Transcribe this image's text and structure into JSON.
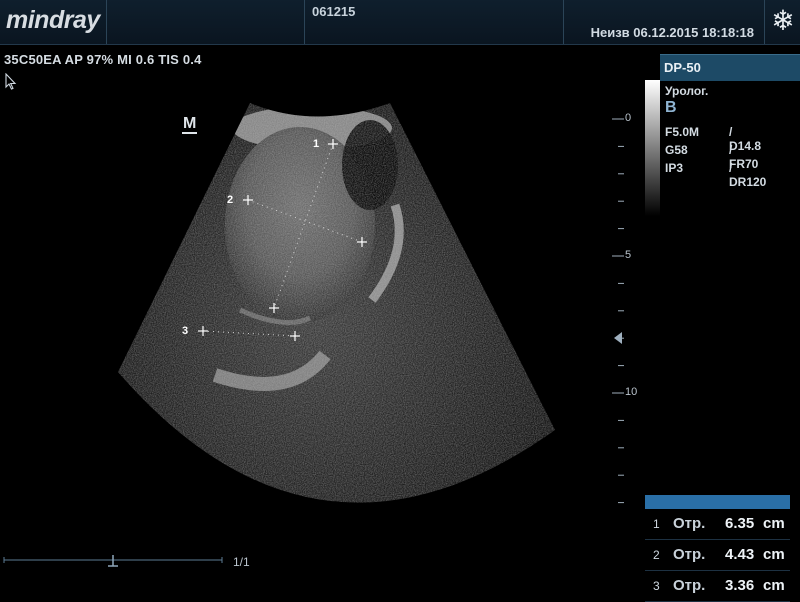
{
  "header": {
    "logo": "mindray",
    "patient_id": "061215",
    "datetime": "Неизв 06.12.2015   18:18:18",
    "freeze_icon": "snowflake-icon"
  },
  "probe_info": "35C50EA  AP 97%  MI 0.6 TIS 0.4",
  "orientation_marker": "M",
  "depth_scale": {
    "labels": [
      "0",
      "5",
      "10"
    ],
    "max_cm": 14.8
  },
  "side_panel": {
    "mode_title": "DP-50",
    "preset": "Уролог.",
    "mode": "B",
    "params": [
      {
        "left": "F5.0M",
        "right": "/ D14.8"
      },
      {
        "left": "G58",
        "right": "/ FR70"
      },
      {
        "left": "IP3",
        "right": "/ DR120"
      }
    ]
  },
  "calipers": [
    {
      "label": "1"
    },
    {
      "label": "2"
    },
    {
      "label": "3"
    }
  ],
  "measurements": [
    {
      "index": "1",
      "label": "Отр.",
      "value": "6.35",
      "unit": "cm"
    },
    {
      "index": "2",
      "label": "Отр.",
      "value": "4.43",
      "unit": "cm"
    },
    {
      "index": "3",
      "label": "Отр.",
      "value": "3.36",
      "unit": "cm"
    }
  ],
  "cine": {
    "frame_counter": "1/1"
  },
  "colors": {
    "accent": "#2a6fa7",
    "header_bg": "#1d4a66"
  }
}
